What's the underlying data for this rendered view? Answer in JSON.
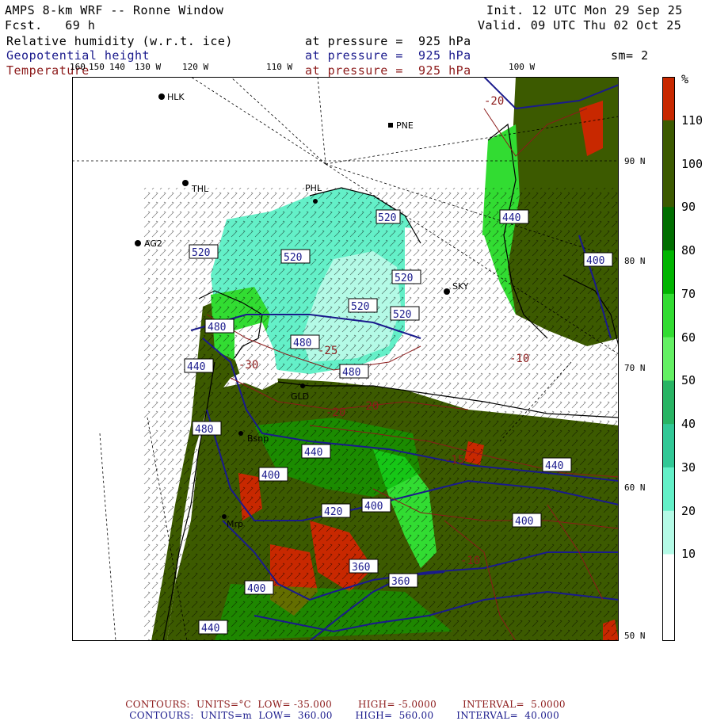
{
  "header": {
    "title": "AMPS 8-km WRF -- Ronne Window",
    "init": "Init. 12 UTC Mon 29 Sep 25",
    "fcst": "Fcst.   69 h",
    "valid": "Valid. 09 UTC Thu 02 Oct 25",
    "fields": [
      {
        "name": "Relative humidity (w.r.t. ice)",
        "level": "at pressure =  925 hPa"
      },
      {
        "name": "Geopotential height",
        "level": "at pressure =  925 hPa"
      },
      {
        "name": "Temperature",
        "level": "at pressure =  925 hPa"
      }
    ],
    "smoothing": "sm= 2"
  },
  "lon_labels_top": [
    "160",
    "150",
    "140",
    "130 W",
    "120 W",
    "110 W",
    "100 W"
  ],
  "lat_labels_right": [
    "90 N",
    "80 N",
    "70 N",
    "60 N",
    "50 N"
  ],
  "legend": {
    "unit": "%",
    "labels": [
      "110",
      "100",
      "90",
      "80",
      "70",
      "60",
      "50",
      "40",
      "30",
      "20",
      "10"
    ],
    "colors": [
      "#c82800",
      "#3c5a00",
      "#3c5a00",
      "#006e00",
      "#00b400",
      "#32dc32",
      "#64f064",
      "#28b464",
      "#32c896",
      "#64f0c8",
      "#b4fae6",
      "#ffffff",
      "#ffffff"
    ]
  },
  "stations": [
    "HLK",
    "PNE",
    "THL",
    "PHL",
    "AG2",
    "SKY",
    "GLD",
    "Bsnp",
    "Mrp"
  ],
  "height_contour_labels": [
    "520",
    "520",
    "520",
    "520",
    "520",
    "480",
    "480",
    "480",
    "440",
    "440",
    "440",
    "400",
    "400",
    "400",
    "400",
    "440",
    "440",
    "480",
    "400",
    "440",
    "360",
    "360",
    "420"
  ],
  "temp_contour_labels": [
    "-20",
    "-25",
    "-30",
    "-10",
    "-20",
    "-20",
    "-15",
    "-10"
  ],
  "footer": {
    "temp": {
      "label": "CONTOURS:",
      "units": "UNITS=°C",
      "low": "LOW= -35.000",
      "high": "HIGH= -5.0000",
      "interval": "INTERVAL=  5.0000"
    },
    "height": {
      "label": "CONTOURS:",
      "units": "UNITS=m",
      "low": "LOW=  360.00",
      "high": "HIGH=  560.00",
      "interval": "INTERVAL=  40.000"
    }
  }
}
